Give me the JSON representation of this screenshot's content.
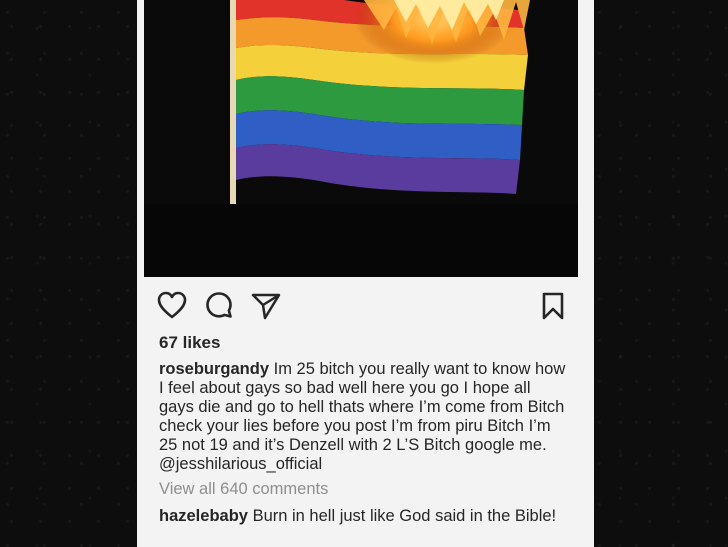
{
  "post": {
    "likes_text": "67 likes",
    "caption": {
      "username": "roseburgandy",
      "text": "Im 25 bitch you really want to know how I feel about gays so bad well here you go I hope all gays die and go to hell thats where I’m come from Bitch check your lies before you post I’m from piru Bitch I’m 25 not 19 and it’s Denzell with 2 L’S Bitch google me.",
      "mention": "@jesshilarious_official"
    },
    "view_all_comments": "View all 640 comments",
    "comment": {
      "username": "hazelebaby",
      "text": "Burn in hell just like God said in the Bible!"
    }
  },
  "icons": {
    "like": "heart-icon",
    "comment": "comment-bubble-icon",
    "share": "paper-plane-icon",
    "save": "bookmark-icon"
  },
  "colors": {
    "text": "#262626",
    "muted": "#8e8e8e",
    "background": "#f3f3f3"
  }
}
